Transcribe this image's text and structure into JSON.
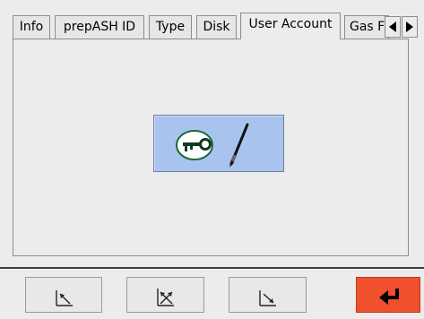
{
  "tabs": {
    "items": [
      {
        "label": "Info"
      },
      {
        "label": "prepASH ID"
      },
      {
        "label": "Type"
      },
      {
        "label": "Disk"
      },
      {
        "label": "User Account",
        "active": true
      },
      {
        "label": "Gas F"
      }
    ],
    "scroll_left_icon": "triangle-left-icon",
    "scroll_right_icon": "triangle-right-icon"
  },
  "panel": {
    "main_button_icons": [
      "key-icon",
      "pen-icon"
    ],
    "main_button_color": "#a8c4ee"
  },
  "bottom_bar": {
    "buttons": [
      {
        "icon": "arrow-up-left-icon"
      },
      {
        "icon": "arrow-cross-icon"
      },
      {
        "icon": "arrow-down-right-icon"
      },
      {
        "icon": "enter-return-icon",
        "color": "#f0502c"
      }
    ]
  }
}
